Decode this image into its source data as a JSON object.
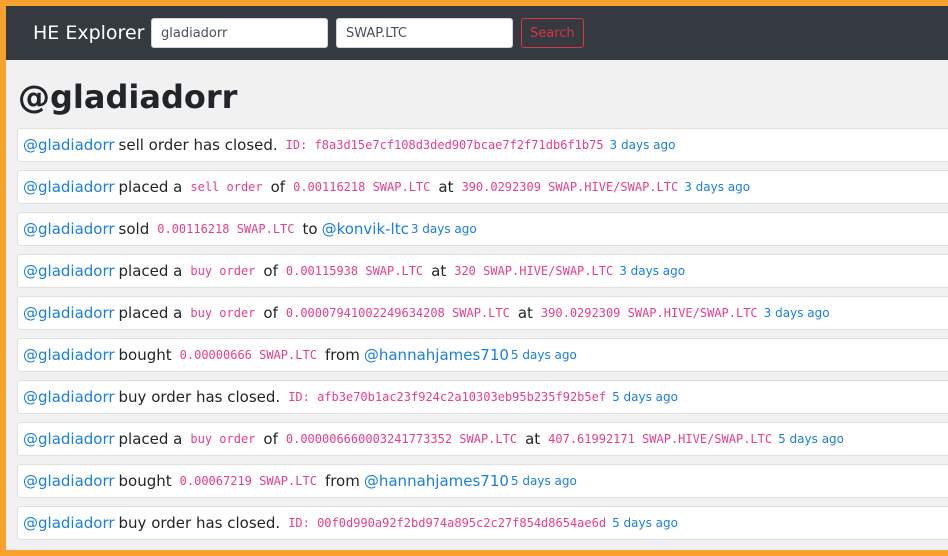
{
  "navbar": {
    "brand": "HE Explorer",
    "account_input": "gladiadorr",
    "token_input": "SWAP.LTC",
    "search_label": "Search"
  },
  "title": "@gladiadorr",
  "activity": [
    [
      {
        "k": "user",
        "t": "@gladiadorr"
      },
      {
        "k": "txt",
        "t": "sell order has closed."
      },
      {
        "k": "code",
        "t": "ID: f8a3d15e7cf108d3ded907bcae7f2f71db6f1b75"
      },
      {
        "k": "time",
        "t": "3 days ago"
      }
    ],
    [
      {
        "k": "user",
        "t": "@gladiadorr"
      },
      {
        "k": "txt",
        "t": "placed a"
      },
      {
        "k": "code",
        "t": "sell order"
      },
      {
        "k": "txt",
        "t": "of"
      },
      {
        "k": "code",
        "t": "0.00116218 SWAP.LTC"
      },
      {
        "k": "txt",
        "t": "at"
      },
      {
        "k": "code",
        "t": "390.0292309 SWAP.HIVE/SWAP.LTC"
      },
      {
        "k": "time",
        "t": "3 days ago"
      }
    ],
    [
      {
        "k": "user",
        "t": "@gladiadorr"
      },
      {
        "k": "txt",
        "t": "sold"
      },
      {
        "k": "code",
        "t": "0.00116218 SWAP.LTC"
      },
      {
        "k": "txt",
        "t": "to"
      },
      {
        "k": "user",
        "t": "@konvik-ltc"
      },
      {
        "k": "time",
        "t": "3 days ago"
      }
    ],
    [
      {
        "k": "user",
        "t": "@gladiadorr"
      },
      {
        "k": "txt",
        "t": "placed a"
      },
      {
        "k": "code",
        "t": "buy order"
      },
      {
        "k": "txt",
        "t": "of"
      },
      {
        "k": "code",
        "t": "0.00115938 SWAP.LTC"
      },
      {
        "k": "txt",
        "t": "at"
      },
      {
        "k": "code",
        "t": "320 SWAP.HIVE/SWAP.LTC"
      },
      {
        "k": "time",
        "t": "3 days ago"
      }
    ],
    [
      {
        "k": "user",
        "t": "@gladiadorr"
      },
      {
        "k": "txt",
        "t": "placed a"
      },
      {
        "k": "code",
        "t": "buy order"
      },
      {
        "k": "txt",
        "t": "of"
      },
      {
        "k": "code",
        "t": "0.00007941002249634208 SWAP.LTC"
      },
      {
        "k": "txt",
        "t": "at"
      },
      {
        "k": "code",
        "t": "390.0292309 SWAP.HIVE/SWAP.LTC"
      },
      {
        "k": "time",
        "t": "3 days ago"
      }
    ],
    [
      {
        "k": "user",
        "t": "@gladiadorr"
      },
      {
        "k": "txt",
        "t": "bought"
      },
      {
        "k": "code",
        "t": "0.00000666 SWAP.LTC"
      },
      {
        "k": "txt",
        "t": "from"
      },
      {
        "k": "user",
        "t": "@hannahjames710"
      },
      {
        "k": "time",
        "t": "5 days ago"
      }
    ],
    [
      {
        "k": "user",
        "t": "@gladiadorr"
      },
      {
        "k": "txt",
        "t": "buy order has closed."
      },
      {
        "k": "code",
        "t": "ID: afb3e70b1ac23f924c2a10303eb95b235f92b5ef"
      },
      {
        "k": "time",
        "t": "5 days ago"
      }
    ],
    [
      {
        "k": "user",
        "t": "@gladiadorr"
      },
      {
        "k": "txt",
        "t": "placed a"
      },
      {
        "k": "code",
        "t": "buy order"
      },
      {
        "k": "txt",
        "t": "of"
      },
      {
        "k": "code",
        "t": "0.000006660003241773352 SWAP.LTC"
      },
      {
        "k": "txt",
        "t": "at"
      },
      {
        "k": "code",
        "t": "407.61992171 SWAP.HIVE/SWAP.LTC"
      },
      {
        "k": "time",
        "t": "5 days ago"
      }
    ],
    [
      {
        "k": "user",
        "t": "@gladiadorr"
      },
      {
        "k": "txt",
        "t": "bought"
      },
      {
        "k": "code",
        "t": "0.00067219 SWAP.LTC"
      },
      {
        "k": "txt",
        "t": "from"
      },
      {
        "k": "user",
        "t": "@hannahjames710"
      },
      {
        "k": "time",
        "t": "5 days ago"
      }
    ],
    [
      {
        "k": "user",
        "t": "@gladiadorr"
      },
      {
        "k": "txt",
        "t": "buy order has closed."
      },
      {
        "k": "code",
        "t": "ID: 00f0d990a92f2bd974a895c2c27f854d8654ae6d"
      },
      {
        "k": "time",
        "t": "5 days ago"
      }
    ]
  ]
}
